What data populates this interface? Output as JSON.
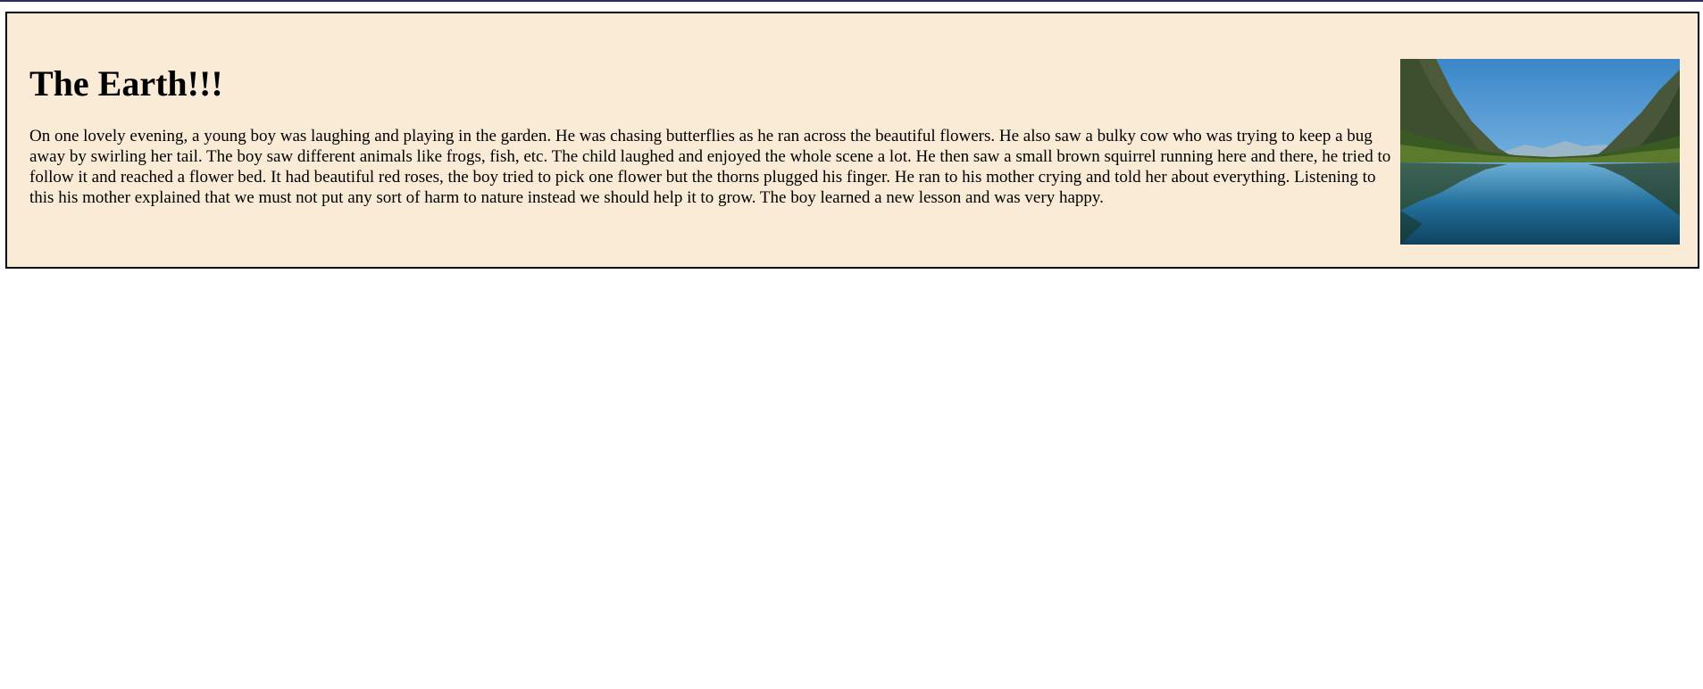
{
  "article": {
    "title": "The Earth!!!",
    "body": "On one lovely evening, a young boy was laughing and playing in the garden. He was chasing butterflies as he ran across the beautiful flowers. He also saw a bulky cow who was trying to keep a bug away by swirling her tail. The boy saw different animals like frogs, fish, etc. The child laughed and enjoyed the whole scene a lot. He then saw a small brown squirrel running here and there, he tried to follow it and reached a flower bed. It had beautiful red roses, the boy tried to pick one flower but the thorns plugged his finger. He ran to his mother crying and told her about everything. Listening to this his mother explained that we must not put any sort of harm to nature instead we should help it to grow. The boy learned a new lesson and was very happy.",
    "image": {
      "subject": "mountain lake landscape",
      "colors": {
        "sky": "#5fa3dc",
        "water": "#1f6f9a",
        "forest": "#2f4a22"
      }
    }
  },
  "colors": {
    "card_background": "#faebd7",
    "border": "#000000",
    "top_rule": "#2b2b6b"
  }
}
